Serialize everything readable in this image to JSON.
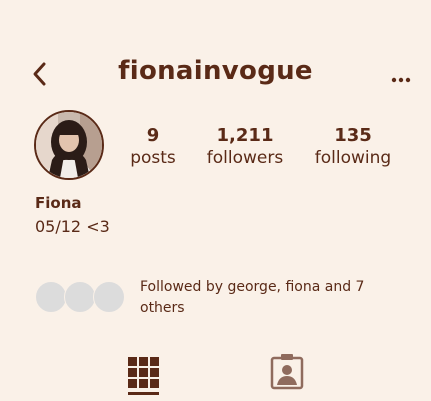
{
  "header": {
    "username": "fionainvogue",
    "back_icon": "chevron-left-icon",
    "more_icon": "ellipsis-icon"
  },
  "profile": {
    "stats": [
      {
        "value": "9",
        "label": "posts"
      },
      {
        "value": "1,211",
        "label": "followers"
      },
      {
        "value": "135",
        "label": "following"
      }
    ],
    "name": "Fiona",
    "bio": "05/12 <3",
    "followed_by": "Followed by george, fiona and 7 others"
  },
  "tabs": [
    {
      "icon": "grid-icon",
      "active": true
    },
    {
      "icon": "tagged-person-icon",
      "active": false
    }
  ],
  "colors": {
    "background": "#faf1e8",
    "primary_text": "#5a2a17",
    "placeholder_avatar": "#dcdcdc",
    "inactive_icon": "#8f6b5d"
  }
}
